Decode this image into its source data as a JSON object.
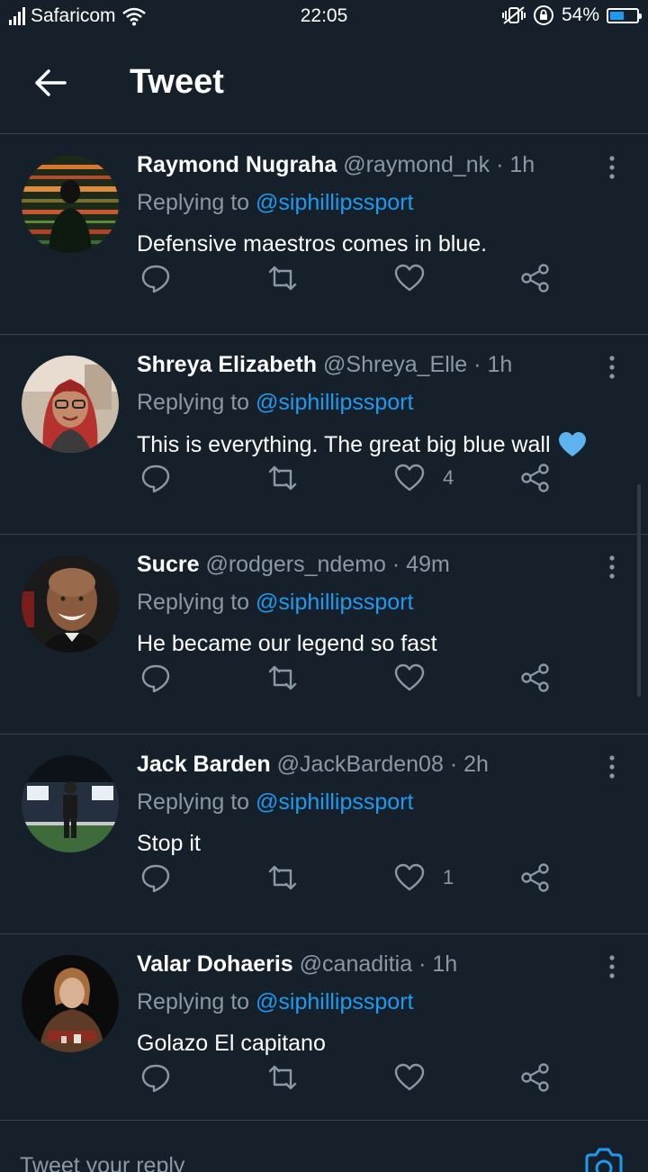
{
  "status_bar": {
    "carrier": "Safaricom",
    "time": "22:05",
    "battery": "54%",
    "battery_level": 0.54
  },
  "header": {
    "title": "Tweet"
  },
  "replies": [
    {
      "name": "Raymond Nugraha",
      "handle": "@raymond_nk",
      "time": "· 1h",
      "replying_prefix": "Replying to",
      "replying_to": "@siphillipssport",
      "text": "Defensive maestros comes in blue.",
      "likes": "",
      "emoji": ""
    },
    {
      "name": "Shreya Elizabeth",
      "handle": "@Shreya_Elle",
      "time": "· 1h",
      "replying_prefix": "Replying to",
      "replying_to": "@siphillipssport",
      "text": "This is everything. The great big blue wall",
      "likes": "4",
      "emoji": "blue-heart"
    },
    {
      "name": "Sucre",
      "handle": "@rodgers_ndemo",
      "time": "· 49m",
      "replying_prefix": "Replying to",
      "replying_to": "@siphillipssport",
      "text": "He became our legend so fast",
      "likes": "",
      "emoji": ""
    },
    {
      "name": "Jack Barden",
      "handle": "@JackBarden08",
      "time": "· 2h",
      "replying_prefix": "Replying to",
      "replying_to": "@siphillipssport",
      "text": "Stop it",
      "likes": "1",
      "emoji": ""
    },
    {
      "name": "Valar Dohaeris",
      "handle": "@canaditia",
      "time": "· 1h",
      "replying_prefix": "Replying to",
      "replying_to": "@siphillipssport",
      "text": "Golazo El capitano",
      "likes": "",
      "emoji": ""
    }
  ],
  "compose": {
    "placeholder": "Tweet your reply"
  },
  "colors": {
    "background": "#15202b",
    "accent": "#1d9bf0",
    "secondary_text": "#8b98a5",
    "divider": "#38444d"
  }
}
